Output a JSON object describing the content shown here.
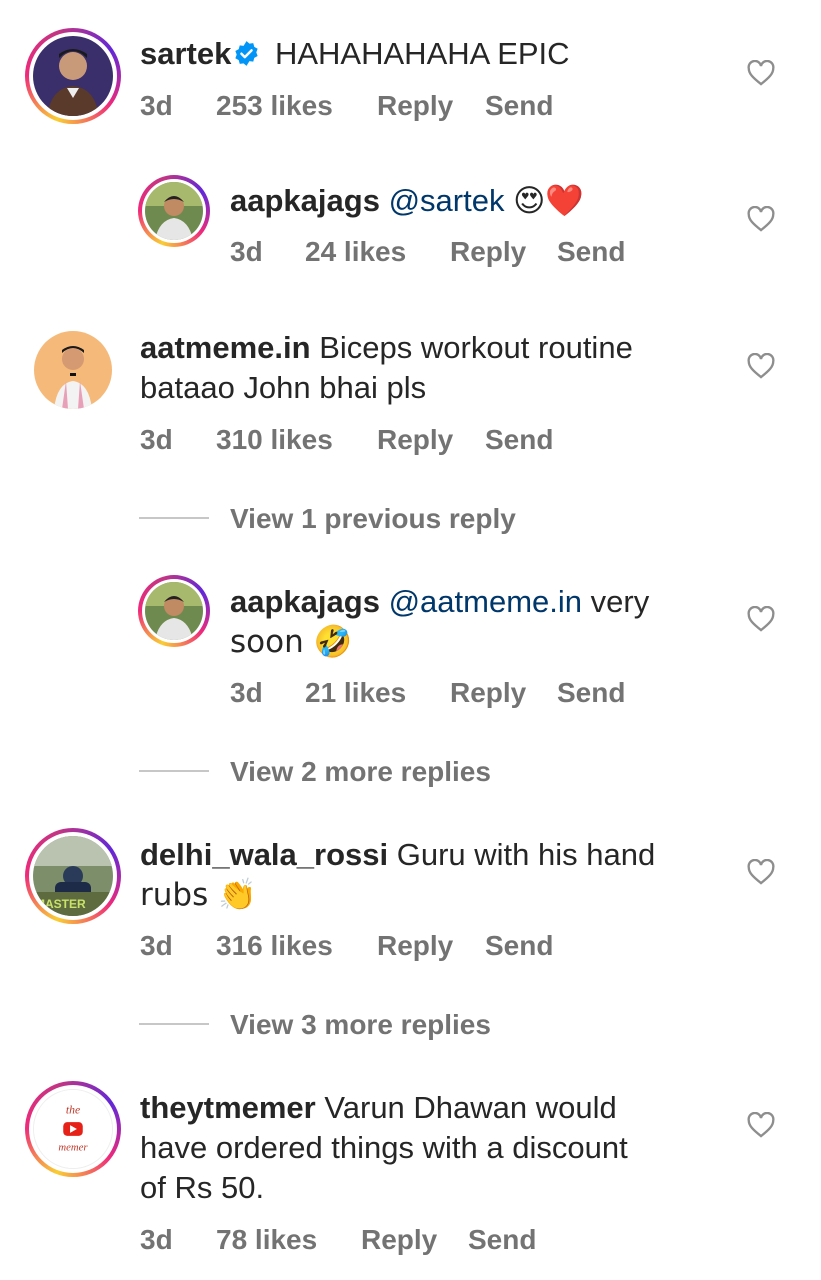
{
  "comments": [
    {
      "username": "sartek",
      "verified": true,
      "text": "HAHAHAHAHA EPIC",
      "time": "3d",
      "likes": "253 likes",
      "reply": "Reply",
      "send": "Send"
    },
    {
      "username": "aapkajags",
      "mention": "@sartek",
      "text": "😍❤️",
      "time": "3d",
      "likes": "24 likes",
      "reply": "Reply",
      "send": "Send"
    },
    {
      "username": "aatmeme.in",
      "text_line1": "Biceps workout routine",
      "text_line2": "bataao John bhai pls",
      "time": "3d",
      "likes": "310 likes",
      "reply": "Reply",
      "send": "Send"
    },
    {
      "view_more": "View 1 previous reply"
    },
    {
      "username": "aapkajags",
      "mention": "@aatmeme.in",
      "text_line1": "very",
      "text_line2": "soon 🤣",
      "time": "3d",
      "likes": "21 likes",
      "reply": "Reply",
      "send": "Send"
    },
    {
      "view_more": "View 2 more replies"
    },
    {
      "username": "delhi_wala_rossi",
      "text_line1": "Guru with his hand",
      "text_line2": "rubs 👏",
      "time": "3d",
      "likes": "316 likes",
      "reply": "Reply",
      "send": "Send"
    },
    {
      "view_more": "View 3 more replies"
    },
    {
      "username": "theytmemer",
      "text_line1": "Varun Dhawan would",
      "text_line2": "have ordered things with a discount",
      "text_line3": "of Rs 50.",
      "time": "3d",
      "likes": "78 likes",
      "reply": "Reply",
      "send": "Send",
      "avatar_text_top": "the",
      "avatar_text_bottom": "memer"
    }
  ],
  "icons": {
    "like": "heart-outline-icon",
    "verified": "verified-badge-icon"
  },
  "colors": {
    "mention": "#00376b",
    "meta": "#737373",
    "verified": "#0095f6"
  }
}
